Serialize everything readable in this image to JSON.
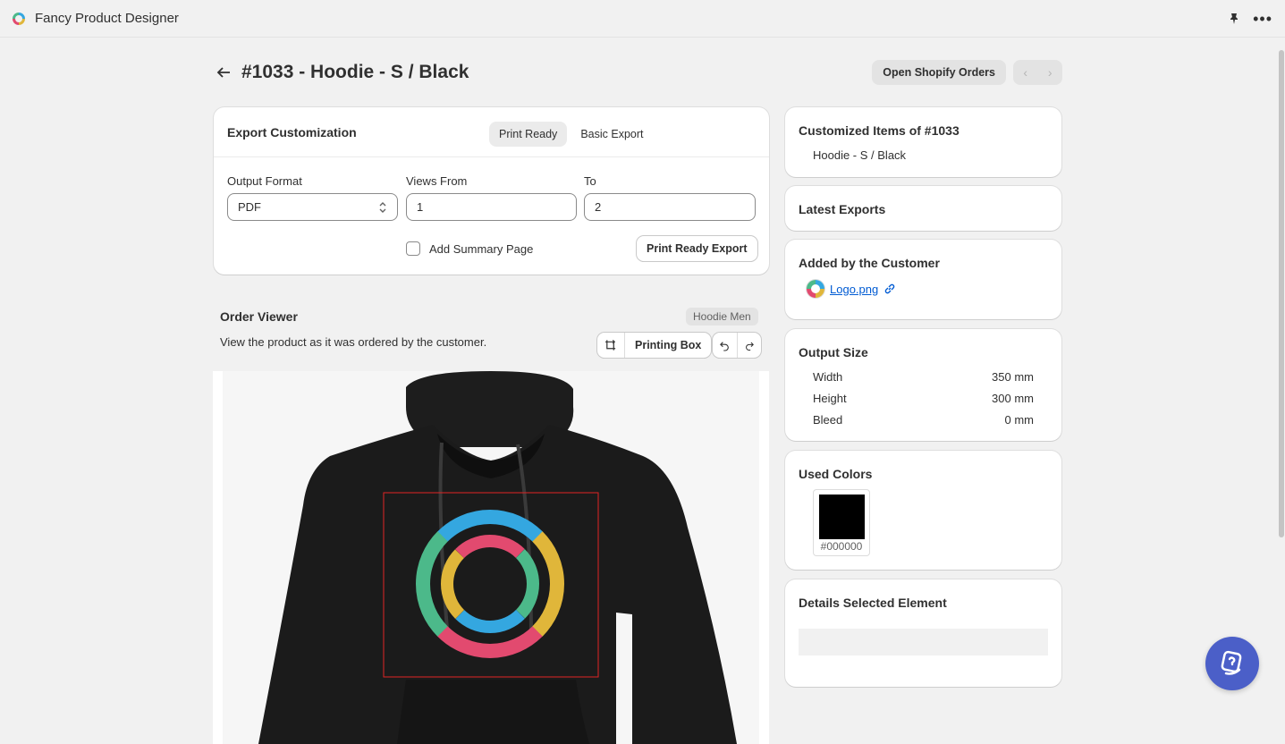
{
  "app": {
    "title": "Fancy Product Designer"
  },
  "header": {
    "title": "#1033 - Hoodie - S / Black",
    "open_orders_label": "Open Shopify Orders",
    "prev_icon": "chevron-left-icon",
    "next_icon": "chevron-right-icon"
  },
  "export": {
    "title": "Export Customization",
    "tabs": [
      {
        "label": "Print Ready",
        "active": true
      },
      {
        "label": "Basic Export",
        "active": false
      }
    ],
    "output_format_label": "Output Format",
    "output_format_value": "PDF",
    "views_from_label": "Views From",
    "views_from_value": "1",
    "to_label": "To",
    "to_value": "2",
    "summary_label": "Add Summary Page",
    "summary_checked": false,
    "export_button_label": "Print Ready Export"
  },
  "viewer": {
    "title": "Order Viewer",
    "badge": "Hoodie Men",
    "subtitle": "View the product as it was ordered by the customer.",
    "printing_box_label": "Printing Box"
  },
  "sidebar": {
    "customized_title": "Customized Items of #1033",
    "customized_item": "Hoodie - S / Black",
    "latest_exports_title": "Latest Exports",
    "added_title": "Added by the Customer",
    "added_file": "Logo.png",
    "output_size_title": "Output Size",
    "output_size": [
      {
        "label": "Width",
        "value": "350 mm"
      },
      {
        "label": "Height",
        "value": "300 mm"
      },
      {
        "label": "Bleed",
        "value": "0 mm"
      }
    ],
    "used_colors_title": "Used Colors",
    "used_colors": [
      {
        "hex": "#000000",
        "label": "#000000"
      }
    ],
    "details_title": "Details Selected Element"
  },
  "colors": {
    "accent_link": "#005bd3",
    "chat_button": "#4b5fc8",
    "print_box": "#e02424"
  }
}
